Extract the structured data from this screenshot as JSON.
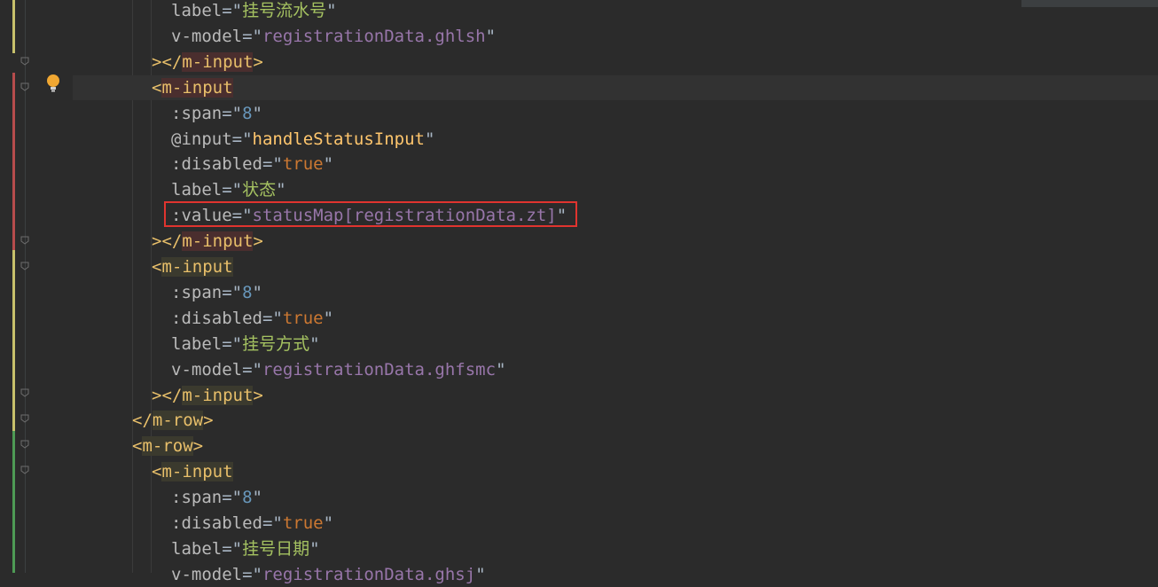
{
  "lines": [
    {
      "indent": 2,
      "attr": "label",
      "value": "挂号流水号",
      "kind": "str"
    },
    {
      "indent": 2,
      "attr": "v-model",
      "value": "registrationData.ghlsh",
      "kind": "str-val"
    },
    {
      "indent": 1,
      "close": "></",
      "tag": "m-input",
      "end": ">"
    },
    {
      "indent": 1,
      "open": "<",
      "tag": "m-input"
    },
    {
      "indent": 2,
      "attr": ":span",
      "value": "8",
      "kind": "str-num"
    },
    {
      "indent": 2,
      "attr": "@input",
      "value": "handleStatusInput",
      "kind": "str-fn"
    },
    {
      "indent": 2,
      "attr": ":disabled",
      "value": "true",
      "kind": "str-kw"
    },
    {
      "indent": 2,
      "attr": "label",
      "value": "状态",
      "kind": "str"
    },
    {
      "indent": 2,
      "attr": ":value",
      "value": "statusMap[registrationData.zt]",
      "kind": "str-val"
    },
    {
      "indent": 1,
      "close": "></",
      "tag": "m-input",
      "end": ">"
    },
    {
      "indent": 1,
      "open": "<",
      "tag": "m-input"
    },
    {
      "indent": 2,
      "attr": ":span",
      "value": "8",
      "kind": "str-num"
    },
    {
      "indent": 2,
      "attr": ":disabled",
      "value": "true",
      "kind": "str-kw"
    },
    {
      "indent": 2,
      "attr": "label",
      "value": "挂号方式",
      "kind": "str"
    },
    {
      "indent": 2,
      "attr": "v-model",
      "value": "registrationData.ghfsmc",
      "kind": "str-val"
    },
    {
      "indent": 1,
      "close": "></",
      "tag": "m-input",
      "end": ">"
    },
    {
      "indent": 0,
      "open": "</",
      "tag": "m-row",
      "end": ">"
    },
    {
      "indent": 0,
      "open": "<",
      "tag": "m-row",
      "end": ">"
    },
    {
      "indent": 1,
      "open": "<",
      "tag": "m-input"
    },
    {
      "indent": 2,
      "attr": ":span",
      "value": "8",
      "kind": "str-num"
    },
    {
      "indent": 2,
      "attr": ":disabled",
      "value": "true",
      "kind": "str-kw"
    },
    {
      "indent": 2,
      "attr": "label",
      "value": "挂号日期",
      "kind": "str"
    },
    {
      "indent": 2,
      "attr": "v-model",
      "value": "registrationData.ghsj",
      "kind": "str-val"
    }
  ],
  "gutter": {
    "bulb_icon": "lightbulb-icon",
    "fold_icon": "fold-marker-icon"
  },
  "colors": {
    "background": "#2b2b2b",
    "highlight_border": "#e0342f",
    "tag": "#e8bf6a",
    "string": "#a5c261",
    "property": "#9876aa"
  }
}
